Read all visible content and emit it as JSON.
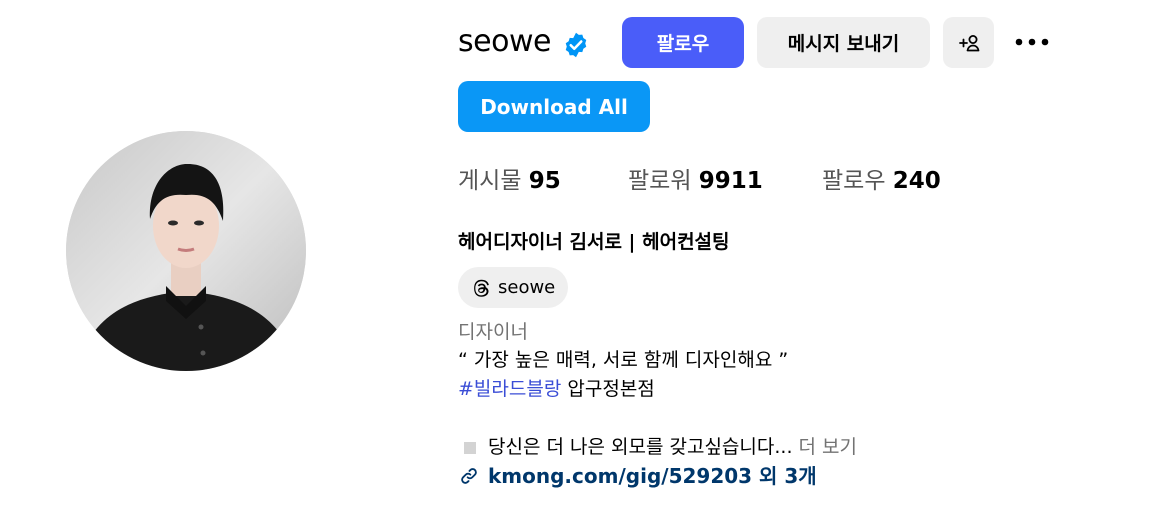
{
  "profile": {
    "username": "seowe",
    "verified": true,
    "accent_color": "#4a5df9",
    "verified_color": "#0095f6"
  },
  "actions": {
    "follow_label": "팔로우",
    "message_label": "메시지 보내기",
    "download_label": "Download All",
    "add_user_icon": "add-user-icon",
    "more_icon": "more-options-icon"
  },
  "stats": {
    "posts_label": "게시물",
    "posts_value": "95",
    "followers_label": "팔로워",
    "followers_value": "9911",
    "following_label": "팔로우",
    "following_value": "240"
  },
  "bio": {
    "name": "헤어디자이너 김서로 | 헤어컨설팅",
    "threads_handle": "seowe",
    "category": "디자이너",
    "quote": "“ 가장 높은 매력, 서로 함께 디자인해요 ”",
    "hashtag": "#빌라드블랑",
    "location": "압구정본점",
    "teaser": "당신은 더 나은 외모를 갖고싶습니다...",
    "more_label": "더 보기",
    "link_text": "kmong.com/gig/529203 외 3개"
  }
}
